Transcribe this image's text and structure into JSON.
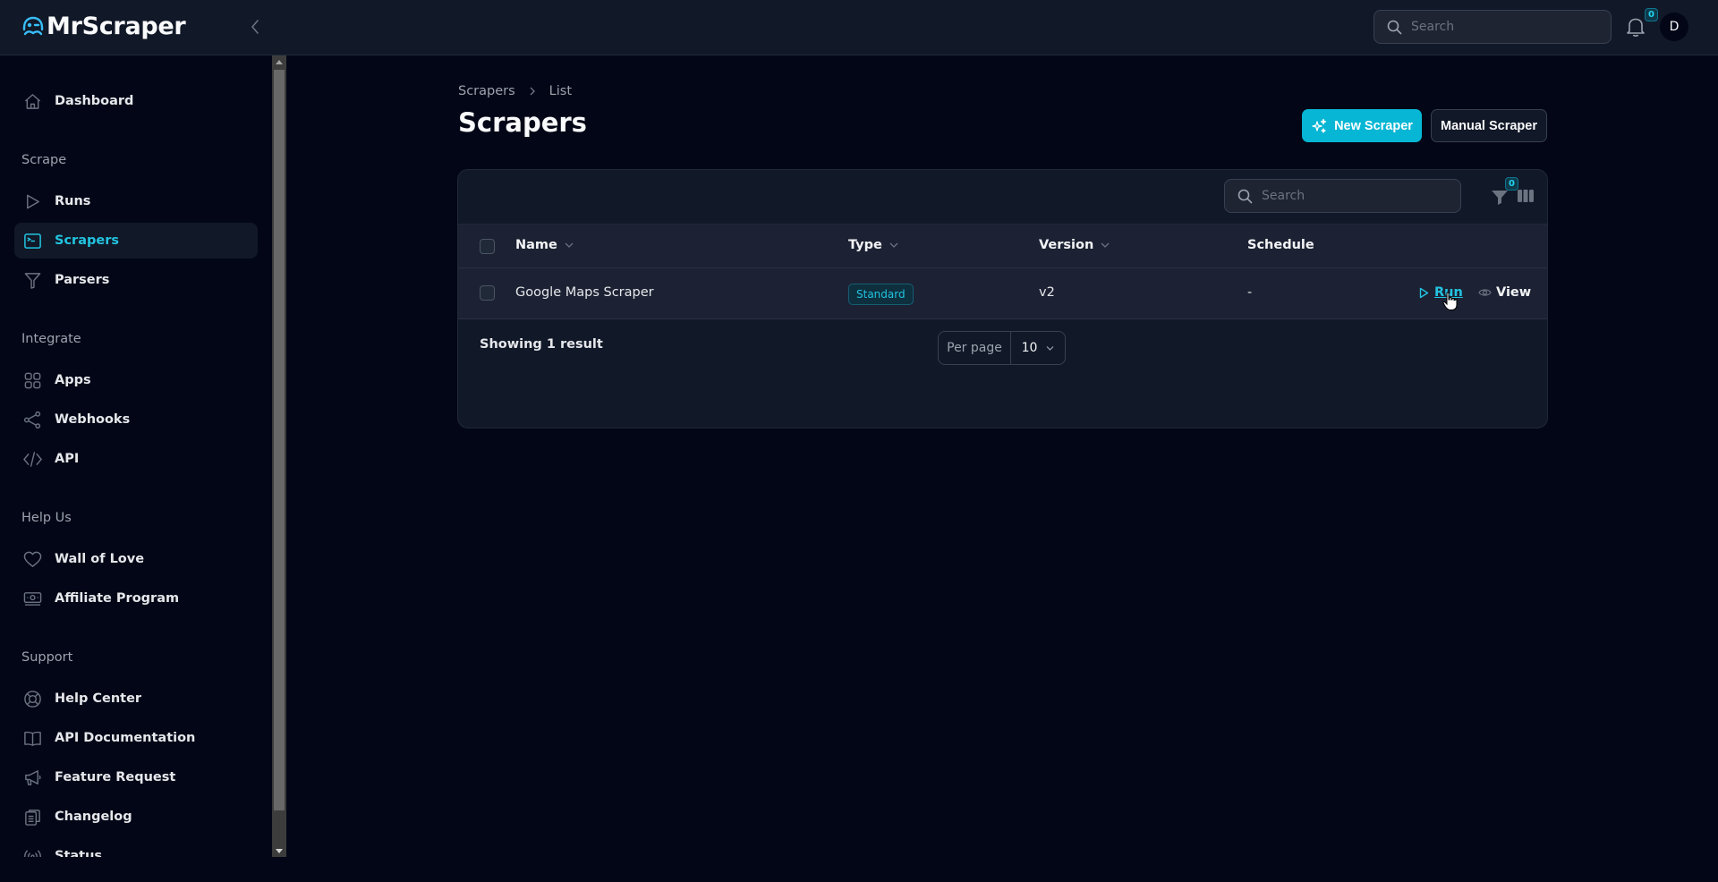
{
  "app": {
    "name": "MrScraper",
    "brand_color": "#06b6d4"
  },
  "topbar": {
    "search_placeholder": "Search",
    "notification_count": "0",
    "avatar_initial": "D"
  },
  "sidebar": {
    "dashboard": {
      "label": "Dashboard",
      "icon": "home-icon"
    },
    "sections": [
      {
        "title": "Scrape",
        "items": [
          {
            "label": "Runs",
            "icon": "play-icon"
          },
          {
            "label": "Scrapers",
            "icon": "terminal-icon",
            "active": true
          },
          {
            "label": "Parsers",
            "icon": "funnel-icon"
          }
        ]
      },
      {
        "title": "Integrate",
        "items": [
          {
            "label": "Apps",
            "icon": "grid-icon"
          },
          {
            "label": "Webhooks",
            "icon": "share-icon"
          },
          {
            "label": "API",
            "icon": "code-icon"
          }
        ]
      },
      {
        "title": "Help Us",
        "items": [
          {
            "label": "Wall of Love",
            "icon": "heart-icon"
          },
          {
            "label": "Affiliate Program",
            "icon": "money-icon"
          }
        ]
      },
      {
        "title": "Support",
        "items": [
          {
            "label": "Help Center",
            "icon": "lifebuoy-icon"
          },
          {
            "label": "API Documentation",
            "icon": "book-icon"
          },
          {
            "label": "Feature Request",
            "icon": "megaphone-icon"
          },
          {
            "label": "Changelog",
            "icon": "clipboard-icon"
          },
          {
            "label": "Status",
            "icon": "signal-icon"
          }
        ]
      }
    ]
  },
  "page": {
    "breadcrumb": [
      "Scrapers",
      "List"
    ],
    "title": "Scrapers",
    "new_button": "New Scraper",
    "manual_button": "Manual Scraper"
  },
  "table": {
    "search_placeholder": "Search",
    "filter_count": "0",
    "columns": [
      "Name",
      "Type",
      "Version",
      "Schedule"
    ],
    "rows": [
      {
        "name": "Google Maps Scraper",
        "type": "Standard",
        "version": "v2",
        "schedule": "-",
        "actions": [
          "Run",
          "View"
        ]
      }
    ],
    "footer": {
      "result_text": "Showing 1 result",
      "per_page_label": "Per page",
      "per_page_value": "10"
    }
  },
  "help_button": "?"
}
